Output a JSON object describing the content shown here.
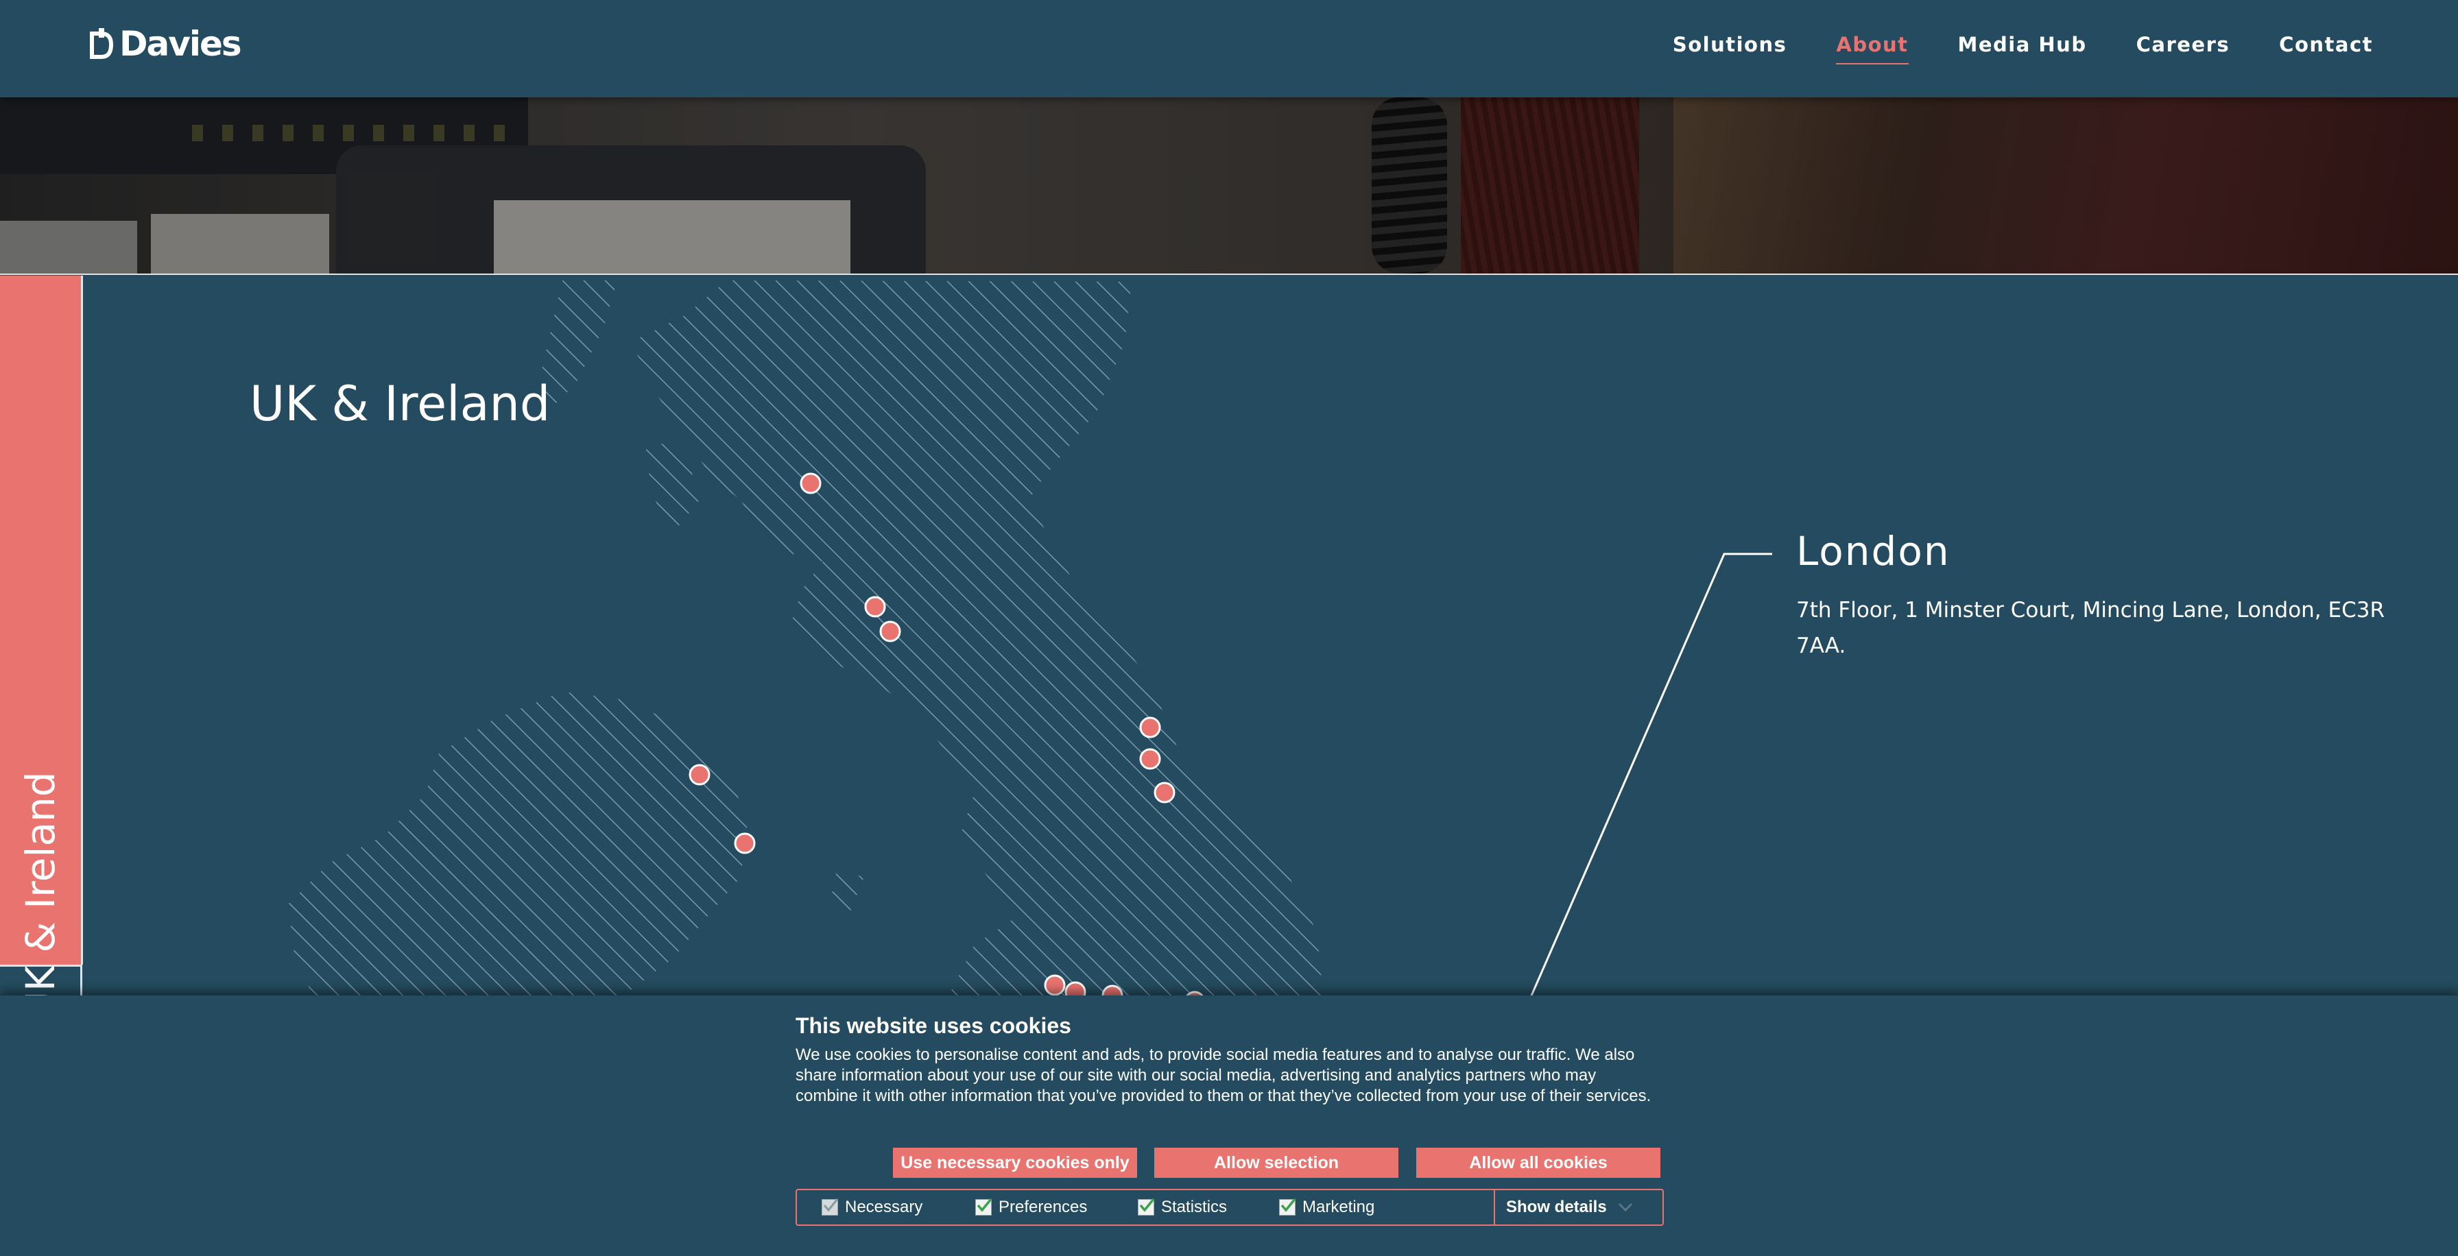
{
  "header": {
    "logo_text": "Davies",
    "nav": [
      {
        "label": "Solutions"
      },
      {
        "label": "About",
        "active": true
      },
      {
        "label": "Media Hub"
      },
      {
        "label": "Careers"
      },
      {
        "label": "Contact"
      }
    ]
  },
  "section": {
    "tab_label": "UK & Ireland",
    "title": "UK & Ireland"
  },
  "office": {
    "name": "London",
    "address": "7th Floor, 1 Minster Court, Mincing Lane, London, EC3R 7AA."
  },
  "cookie_banner": {
    "title": "This website uses cookies",
    "body": "We use cookies to personalise content and ads, to provide social media features and to analyse our traffic. We also share information about your use of our site with our social media, advertising and analytics partners who may combine it with other information that you’ve provided to them or that they’ve collected from your use of their services.",
    "buttons": {
      "necessary": "Use necessary cookies only",
      "selection": "Allow selection",
      "all": "Allow all cookies"
    },
    "options": {
      "necessary": "Necessary",
      "preferences": "Preferences",
      "statistics": "Statistics",
      "marketing": "Marketing"
    },
    "show_details": "Show details"
  },
  "colors": {
    "background": "#244b5f",
    "accent": "#e8736f",
    "map_hatch": "#7a9aab"
  }
}
